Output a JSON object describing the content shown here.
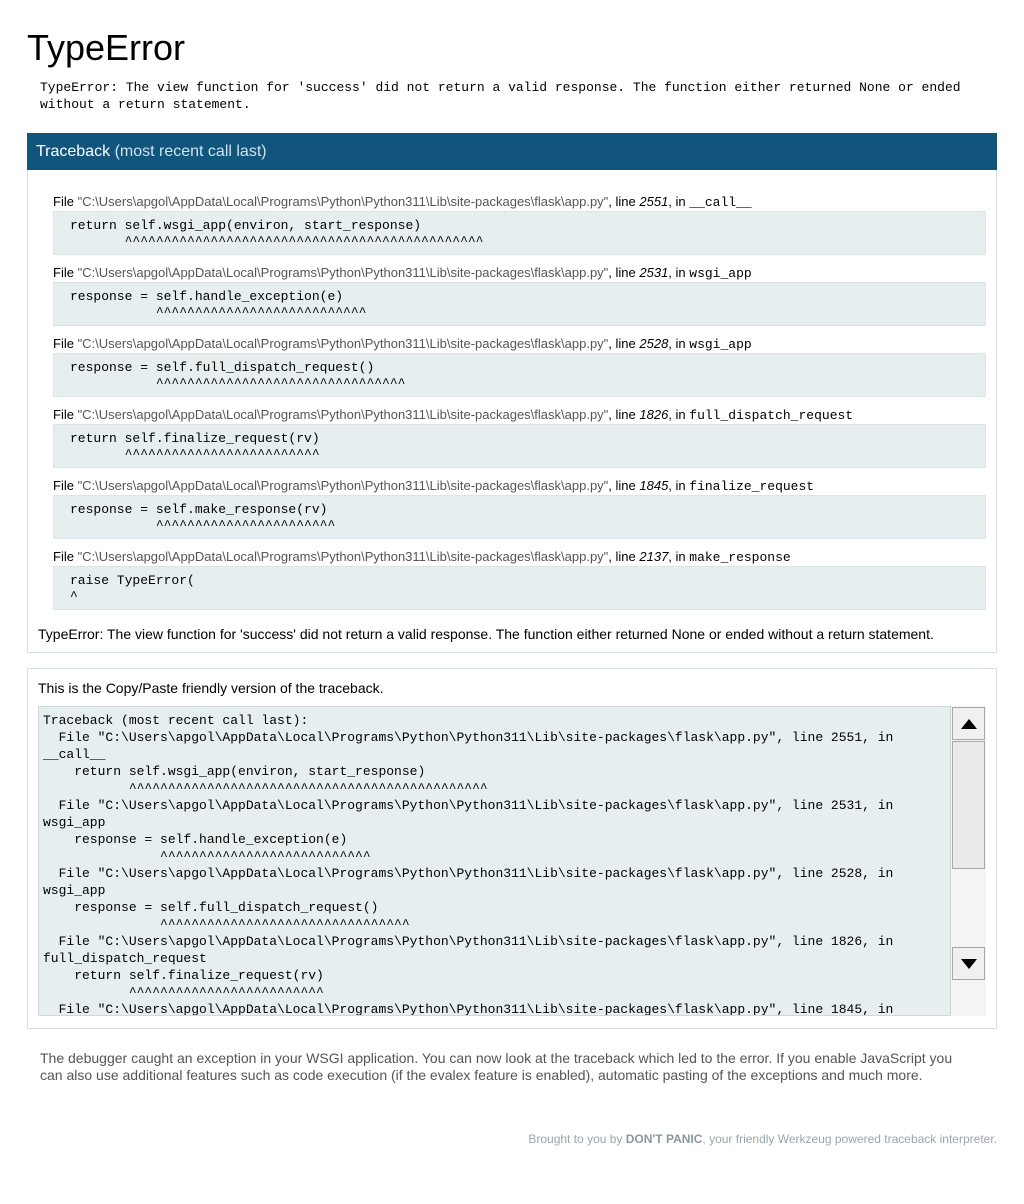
{
  "page": {
    "title": "TypeError",
    "error_message": "TypeError: The view function for 'success' did not return a valid response. The function either returned None or ended without a return statement."
  },
  "traceback": {
    "header_title": "Traceback",
    "header_sub": "(most recent call last)",
    "file_prefix": "File ",
    "line_word": ", line ",
    "in_word": ", in ",
    "frames": [
      {
        "filename": "\"C:\\Users\\apgol\\AppData\\Local\\Programs\\Python\\Python311\\Lib\\site-packages\\flask\\app.py\"",
        "lineno": "2551",
        "function": "__call__",
        "code": "return self.wsgi_app(environ, start_response)\n       ^^^^^^^^^^^^^^^^^^^^^^^^^^^^^^^^^^^^^^^^^^^^^^"
      },
      {
        "filename": "\"C:\\Users\\apgol\\AppData\\Local\\Programs\\Python\\Python311\\Lib\\site-packages\\flask\\app.py\"",
        "lineno": "2531",
        "function": "wsgi_app",
        "code": "response = self.handle_exception(e)\n           ^^^^^^^^^^^^^^^^^^^^^^^^^^^"
      },
      {
        "filename": "\"C:\\Users\\apgol\\AppData\\Local\\Programs\\Python\\Python311\\Lib\\site-packages\\flask\\app.py\"",
        "lineno": "2528",
        "function": "wsgi_app",
        "code": "response = self.full_dispatch_request()\n           ^^^^^^^^^^^^^^^^^^^^^^^^^^^^^^^^"
      },
      {
        "filename": "\"C:\\Users\\apgol\\AppData\\Local\\Programs\\Python\\Python311\\Lib\\site-packages\\flask\\app.py\"",
        "lineno": "1826",
        "function": "full_dispatch_request",
        "code": "return self.finalize_request(rv)\n       ^^^^^^^^^^^^^^^^^^^^^^^^^"
      },
      {
        "filename": "\"C:\\Users\\apgol\\AppData\\Local\\Programs\\Python\\Python311\\Lib\\site-packages\\flask\\app.py\"",
        "lineno": "1845",
        "function": "finalize_request",
        "code": "response = self.make_response(rv)\n           ^^^^^^^^^^^^^^^^^^^^^^^"
      },
      {
        "filename": "\"C:\\Users\\apgol\\AppData\\Local\\Programs\\Python\\Python311\\Lib\\site-packages\\flask\\app.py\"",
        "lineno": "2137",
        "function": "make_response",
        "code": "raise TypeError(\n^"
      }
    ],
    "exception_text": "TypeError: The view function for 'success' did not return a valid response. The function either returned None or ended without a return statement."
  },
  "copy_paste": {
    "intro": "This is the Copy/Paste friendly version of the traceback.",
    "text": "Traceback (most recent call last):\n  File \"C:\\Users\\apgol\\AppData\\Local\\Programs\\Python\\Python311\\Lib\\site-packages\\flask\\app.py\", line 2551, in\n__call__\n    return self.wsgi_app(environ, start_response)\n           ^^^^^^^^^^^^^^^^^^^^^^^^^^^^^^^^^^^^^^^^^^^^^^\n  File \"C:\\Users\\apgol\\AppData\\Local\\Programs\\Python\\Python311\\Lib\\site-packages\\flask\\app.py\", line 2531, in\nwsgi_app\n    response = self.handle_exception(e)\n               ^^^^^^^^^^^^^^^^^^^^^^^^^^^\n  File \"C:\\Users\\apgol\\AppData\\Local\\Programs\\Python\\Python311\\Lib\\site-packages\\flask\\app.py\", line 2528, in\nwsgi_app\n    response = self.full_dispatch_request()\n               ^^^^^^^^^^^^^^^^^^^^^^^^^^^^^^^^\n  File \"C:\\Users\\apgol\\AppData\\Local\\Programs\\Python\\Python311\\Lib\\site-packages\\flask\\app.py\", line 1826, in\nfull_dispatch_request\n    return self.finalize_request(rv)\n           ^^^^^^^^^^^^^^^^^^^^^^^^^\n  File \"C:\\Users\\apgol\\AppData\\Local\\Programs\\Python\\Python311\\Lib\\site-packages\\flask\\app.py\", line 1845, in"
  },
  "explanation": "The debugger caught an exception in your WSGI application. You can now look at the traceback which led to the error. If you enable JavaScript you can also use additional features such as code execution (if the evalex feature is enabled), automatic pasting of the exceptions and much more.",
  "footer": {
    "prefix": "Brought to you by ",
    "brand": "DON'T PANIC",
    "suffix": ", your friendly Werkzeug powered traceback interpreter."
  },
  "icons": {
    "scroll_up": "triangle-up-icon",
    "scroll_down": "triangle-down-icon"
  },
  "colors": {
    "header_bg": "#11557c",
    "code_bg": "#e6eef0",
    "filename_text": "#555555",
    "footer_text": "#9aa5ab"
  }
}
